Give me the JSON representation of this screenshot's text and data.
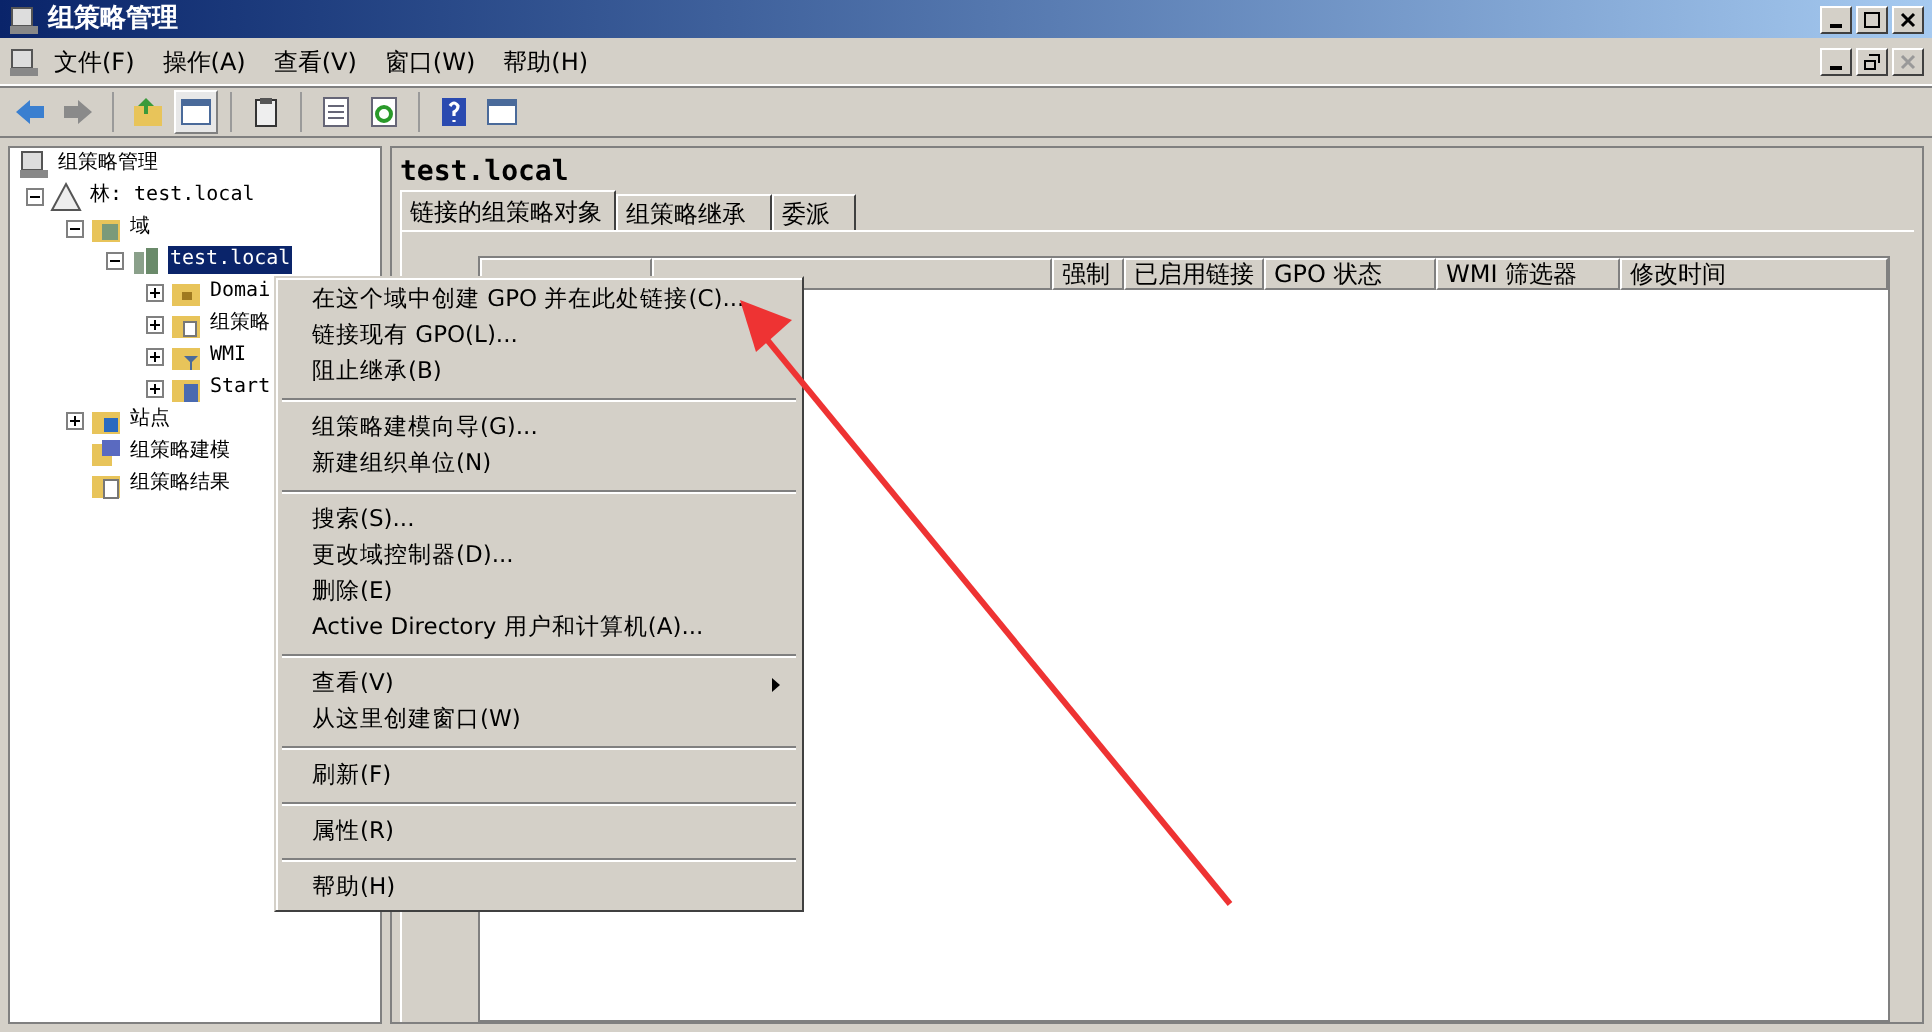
{
  "window": {
    "title": "组策略管理"
  },
  "menu_bar": [
    "文件(F)",
    "操作(A)",
    "查看(V)",
    "窗口(W)",
    "帮助(H)"
  ],
  "toolbar": [
    {
      "kind": "back"
    },
    {
      "kind": "forward"
    },
    {
      "kind": "sep"
    },
    {
      "kind": "up"
    },
    {
      "kind": "pane",
      "selected": true
    },
    {
      "kind": "sep"
    },
    {
      "kind": "clipboard"
    },
    {
      "kind": "sep"
    },
    {
      "kind": "list"
    },
    {
      "kind": "refresh"
    },
    {
      "kind": "sep"
    },
    {
      "kind": "help"
    },
    {
      "kind": "panel"
    }
  ],
  "tree": [
    {
      "label": "组策略管理",
      "kind": "console",
      "children": [
        {
          "label": "林: test.local",
          "kind": "forest",
          "expanded": true,
          "children": [
            {
              "label": "域",
              "kind": "domains",
              "expanded": true,
              "children": [
                {
                  "label": "test.local",
                  "kind": "domain",
                  "expanded": true,
                  "selected": true,
                  "children": [
                    {
                      "label": "Domai",
                      "kind": "folder",
                      "expanded": false,
                      "selected": false
                    },
                    {
                      "label": "组策略",
                      "kind": "gpo",
                      "expanded": false,
                      "selected": false
                    },
                    {
                      "label": "WMI",
                      "kind": "wmi",
                      "expanded": false,
                      "selected": false
                    },
                    {
                      "label": "Start",
                      "kind": "starter",
                      "expanded": false,
                      "selected": false
                    }
                  ]
                }
              ]
            },
            {
              "label": "站点",
              "kind": "sites",
              "expanded": false
            },
            {
              "label": "组策略建模",
              "kind": "modeling"
            },
            {
              "label": "组策略结果",
              "kind": "results"
            }
          ]
        }
      ]
    }
  ],
  "detail": {
    "title": "test.local",
    "tabs": [
      {
        "label": "链接的组策略对象",
        "selected": true
      },
      {
        "label": "组策略继承",
        "selected": false
      },
      {
        "label": "委派",
        "selected": false
      }
    ],
    "columns": [
      "强制",
      "已启用链接",
      "GPO 状态",
      "WMI 筛选器",
      "修改时间"
    ]
  },
  "context_menu": {
    "groups": [
      [
        {
          "label": "在这个域中创建 GPO 并在此处链接(C)...",
          "submenu": false
        },
        {
          "label": "链接现有 GPO(L)...",
          "submenu": false
        },
        {
          "label": "阻止继承(B)",
          "submenu": false
        }
      ],
      [
        {
          "label": "组策略建模向导(G)...",
          "submenu": false
        },
        {
          "label": "新建组织单位(N)",
          "submenu": false
        }
      ],
      [
        {
          "label": "搜索(S)...",
          "submenu": false
        },
        {
          "label": "更改域控制器(D)...",
          "submenu": false
        },
        {
          "label": "删除(E)",
          "submenu": false
        },
        {
          "label": "Active Directory 用户和计算机(A)...",
          "submenu": false
        }
      ],
      [
        {
          "label": "查看(V)",
          "submenu": true
        },
        {
          "label": "从这里创建窗口(W)",
          "submenu": false
        }
      ],
      [
        {
          "label": "刷新(F)",
          "submenu": false
        }
      ],
      [
        {
          "label": "属性(R)",
          "submenu": false
        }
      ],
      [
        {
          "label": "帮助(H)",
          "submenu": false
        }
      ]
    ]
  }
}
